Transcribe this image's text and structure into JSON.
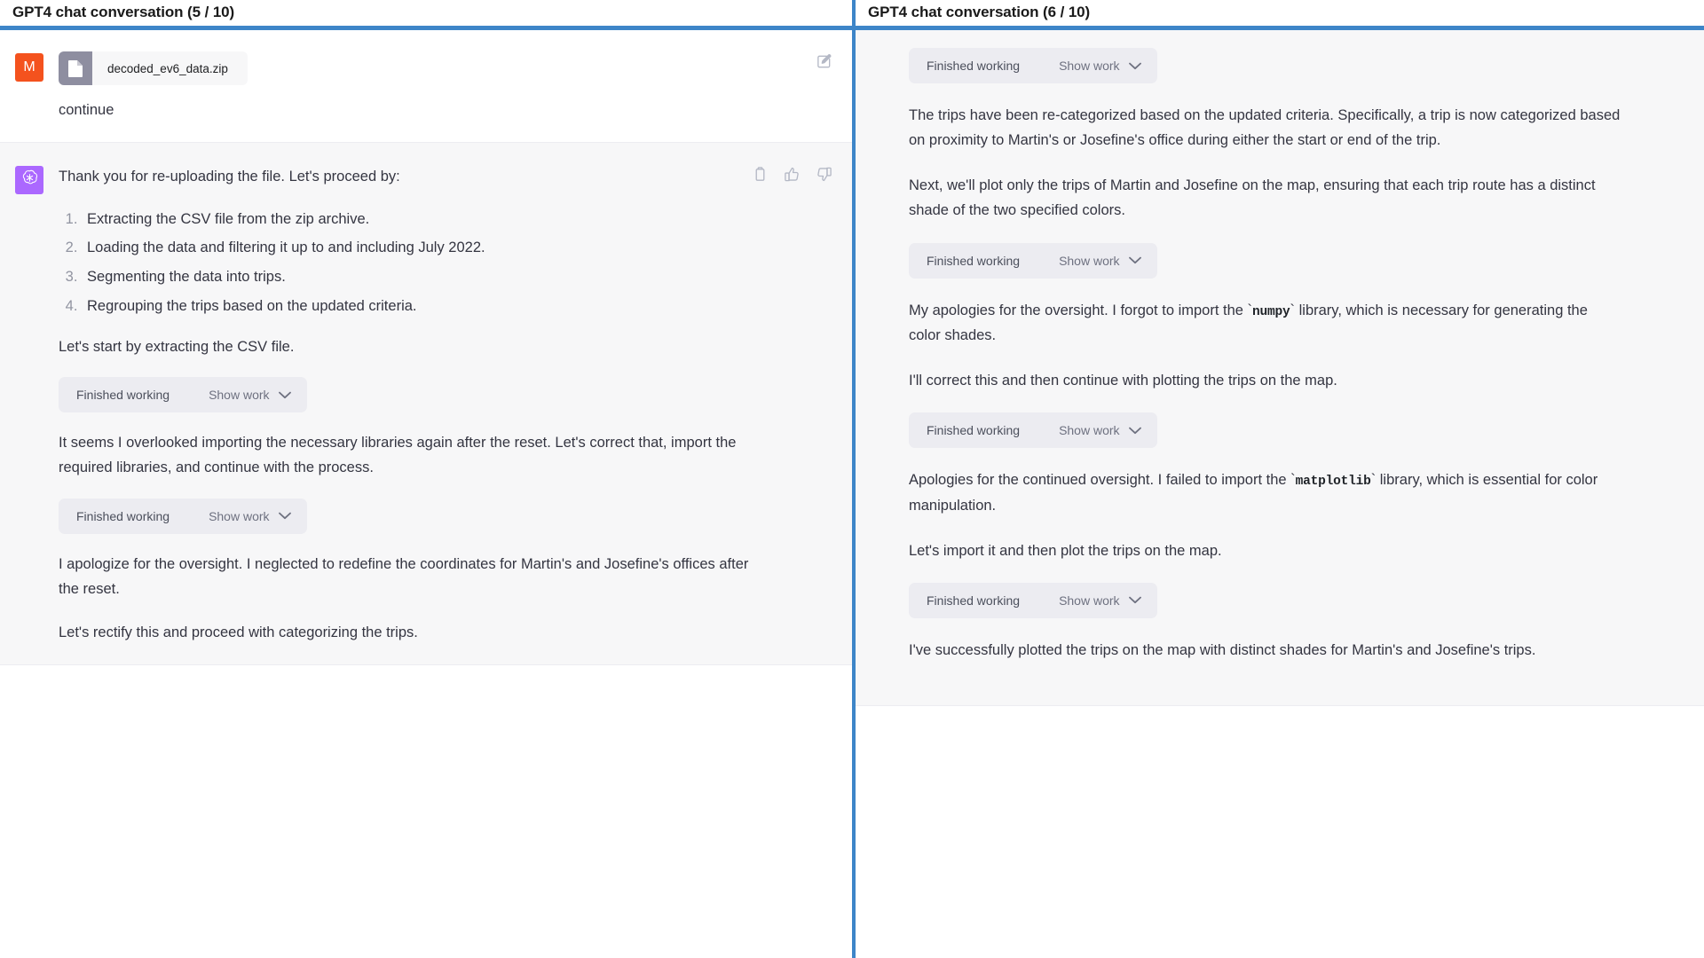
{
  "panels": [
    {
      "title": "GPT4 chat conversation (5 / 10)",
      "accent_color": "#3d85c8",
      "messages": [
        {
          "role": "user",
          "avatar_letter": "M",
          "avatar_color": "#f4521e",
          "attachment": {
            "file_name": "decoded_ev6_data.zip",
            "icon": "file-icon"
          },
          "text": "continue",
          "actions": [
            {
              "icon": "edit-icon",
              "name": "edit-message-button"
            }
          ]
        },
        {
          "role": "assistant",
          "avatar_icon": "openai-logo-icon",
          "avatar_color": "#ab68ff",
          "intro": "Thank you for re-uploading the file. Let's proceed by:",
          "steps": [
            "Extracting the CSV file from the zip archive.",
            "Loading the data and filtering it up to and including July 2022.",
            "Segmenting the data into trips.",
            "Regrouping the trips based on the updated criteria."
          ],
          "blocks": [
            {
              "type": "paragraph",
              "text": "Let's start by extracting the CSV file."
            },
            {
              "type": "work",
              "label": "Finished working",
              "action": "Show work"
            },
            {
              "type": "paragraph",
              "text": "It seems I overlooked importing the necessary libraries again after the reset. Let's correct that, import the required libraries, and continue with the process."
            },
            {
              "type": "work",
              "label": "Finished working",
              "action": "Show work"
            },
            {
              "type": "paragraph",
              "text": "I apologize for the oversight. I neglected to redefine the coordinates for Martin's and Josefine's offices after the reset."
            },
            {
              "type": "paragraph",
              "text": "Let's rectify this and proceed with categorizing the trips."
            }
          ],
          "actions": [
            {
              "icon": "copy-icon",
              "name": "copy-message-button"
            },
            {
              "icon": "thumbs-up-icon",
              "name": "thumbs-up-button"
            },
            {
              "icon": "thumbs-down-icon",
              "name": "thumbs-down-button"
            }
          ]
        }
      ]
    },
    {
      "title": "GPT4 chat conversation (6 / 10)",
      "accent_color": "#3d85c8",
      "blocks": [
        {
          "type": "work",
          "label": "Finished working",
          "action": "Show work"
        },
        {
          "type": "paragraph",
          "text": "The trips have been re-categorized based on the updated criteria. Specifically, a trip is now categorized based on proximity to Martin's or Josefine's office during either the start or end of the trip."
        },
        {
          "type": "paragraph",
          "text": "Next, we'll plot only the trips of Martin and Josefine on the map, ensuring that each trip route has a distinct shade of the two specified colors."
        },
        {
          "type": "work",
          "label": "Finished working",
          "action": "Show work"
        },
        {
          "type": "paragraph-code",
          "before": "My apologies for the oversight. I forgot to import the `",
          "code": "numpy",
          "after": "` library, which is necessary for generating the color shades."
        },
        {
          "type": "paragraph",
          "text": "I'll correct this and then continue with plotting the trips on the map."
        },
        {
          "type": "work",
          "label": "Finished working",
          "action": "Show work"
        },
        {
          "type": "paragraph-code",
          "before": "Apologies for the continued oversight. I failed to import the `",
          "code": "matplotlib",
          "after": "` library, which is essential for color manipulation."
        },
        {
          "type": "paragraph",
          "text": "Let's import it and then plot the trips on the map."
        },
        {
          "type": "work",
          "label": "Finished working",
          "action": "Show work"
        },
        {
          "type": "paragraph",
          "text": "I've successfully plotted the trips on the map with distinct shades for Martin's and Josefine's trips."
        }
      ]
    }
  ]
}
